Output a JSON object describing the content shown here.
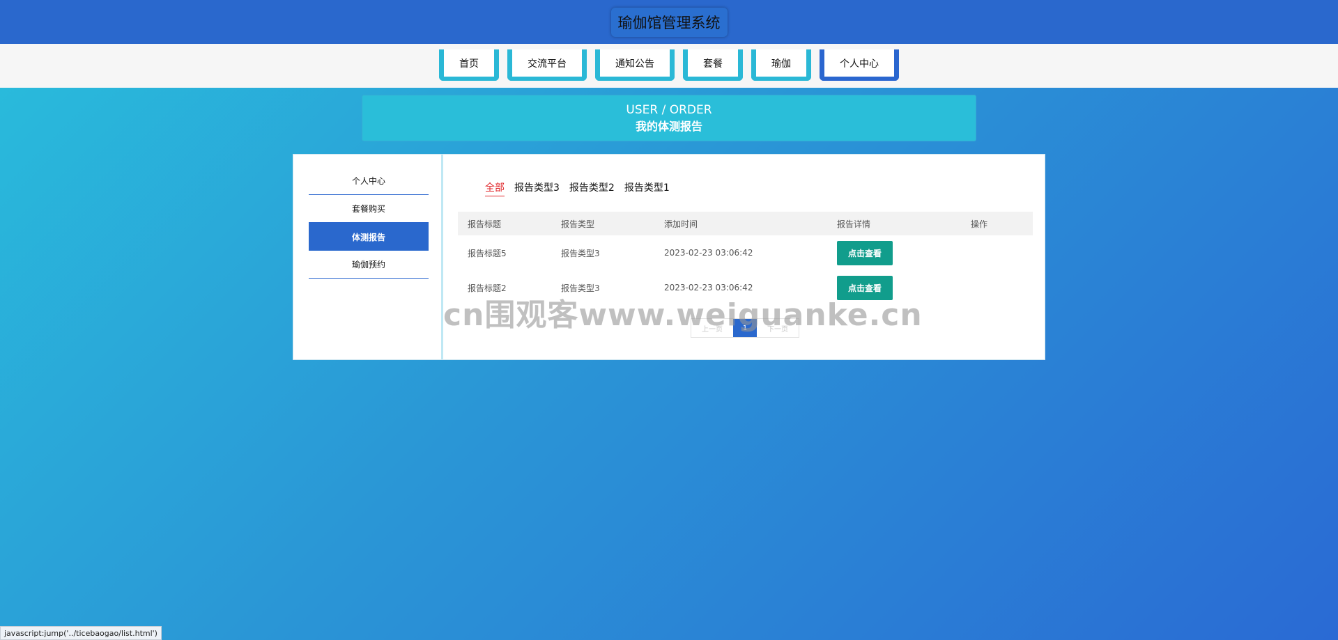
{
  "site": {
    "title": "瑜伽馆管理系统"
  },
  "nav": {
    "items": [
      {
        "label": "首页"
      },
      {
        "label": "交流平台"
      },
      {
        "label": "通知公告"
      },
      {
        "label": "套餐"
      },
      {
        "label": "瑜伽"
      },
      {
        "label": "个人中心"
      }
    ],
    "active_index": 5
  },
  "banner": {
    "en": "USER / ORDER",
    "cn": "我的体测报告"
  },
  "sidebar": {
    "items": [
      {
        "label": "个人中心"
      },
      {
        "label": "套餐购买"
      },
      {
        "label": "体测报告"
      },
      {
        "label": "瑜伽预约"
      }
    ],
    "active_index": 2
  },
  "filters": {
    "tabs": [
      {
        "label": "全部"
      },
      {
        "label": "报告类型3"
      },
      {
        "label": "报告类型2"
      },
      {
        "label": "报告类型1"
      }
    ],
    "active_index": 0
  },
  "table": {
    "headers": [
      "报告标题",
      "报告类型",
      "添加时间",
      "报告详情",
      "操作"
    ],
    "rows": [
      {
        "title": "报告标题5",
        "type": "报告类型3",
        "time": "2023-02-23 03:06:42",
        "detail_button": "点击查看"
      },
      {
        "title": "报告标题2",
        "type": "报告类型3",
        "time": "2023-02-23 03:06:42",
        "detail_button": "点击查看"
      }
    ]
  },
  "pager": {
    "prev": "上一页",
    "current": "1",
    "next": "下一页"
  },
  "watermark": "cn围观客www.weiguanke.cn",
  "status_bar": "javascript:jump('../ticebaogao/list.html')",
  "colors": {
    "header_blue": "#2a68cd",
    "accent_cyan": "#2abed9",
    "button_green": "#119d8c",
    "active_red": "#e0272b"
  }
}
